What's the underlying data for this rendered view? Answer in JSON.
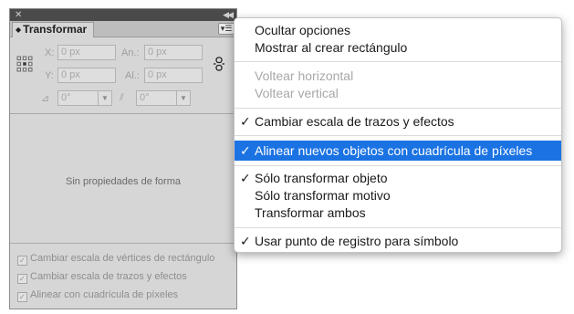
{
  "panel": {
    "tab_label": "Transformar",
    "fields": {
      "x_label": "X:",
      "x_value": "0 px",
      "w_label": "An.:",
      "w_value": "0 px",
      "y_label": "Y:",
      "y_value": "0 px",
      "h_label": "Al.:",
      "h_value": "0 px",
      "rotate_value": "0°",
      "shear_value": "0°"
    },
    "no_properties": "Sin propiedades de forma",
    "checkboxes": [
      {
        "label": "Cambiar escala de vértices de rectángulo",
        "checked": true
      },
      {
        "label": "Cambiar escala de trazos y efectos",
        "checked": true
      },
      {
        "label": "Alinear con cuadrícula de píxeles",
        "checked": true
      }
    ]
  },
  "menu": {
    "items": [
      {
        "label": "Ocultar opciones",
        "checked": false,
        "disabled": false
      },
      {
        "label": "Mostrar al crear rectángulo",
        "checked": false,
        "disabled": false
      },
      {
        "label": "Voltear horizontal",
        "checked": false,
        "disabled": true
      },
      {
        "label": "Voltear vertical",
        "checked": false,
        "disabled": true
      },
      {
        "label": "Cambiar escala de trazos y efectos",
        "checked": true,
        "disabled": false
      },
      {
        "label": "Alinear nuevos objetos con cuadrícula de píxeles",
        "checked": true,
        "disabled": false,
        "selected": true
      },
      {
        "label": "Sólo transformar objeto",
        "checked": true,
        "disabled": false
      },
      {
        "label": "Sólo transformar motivo",
        "checked": false,
        "disabled": false
      },
      {
        "label": "Transformar ambos",
        "checked": false,
        "disabled": false
      },
      {
        "label": "Usar punto de registro para símbolo",
        "checked": true,
        "disabled": false
      }
    ]
  },
  "colors": {
    "highlight": "#1b73e3",
    "panel_bg": "#d6d6d6"
  }
}
